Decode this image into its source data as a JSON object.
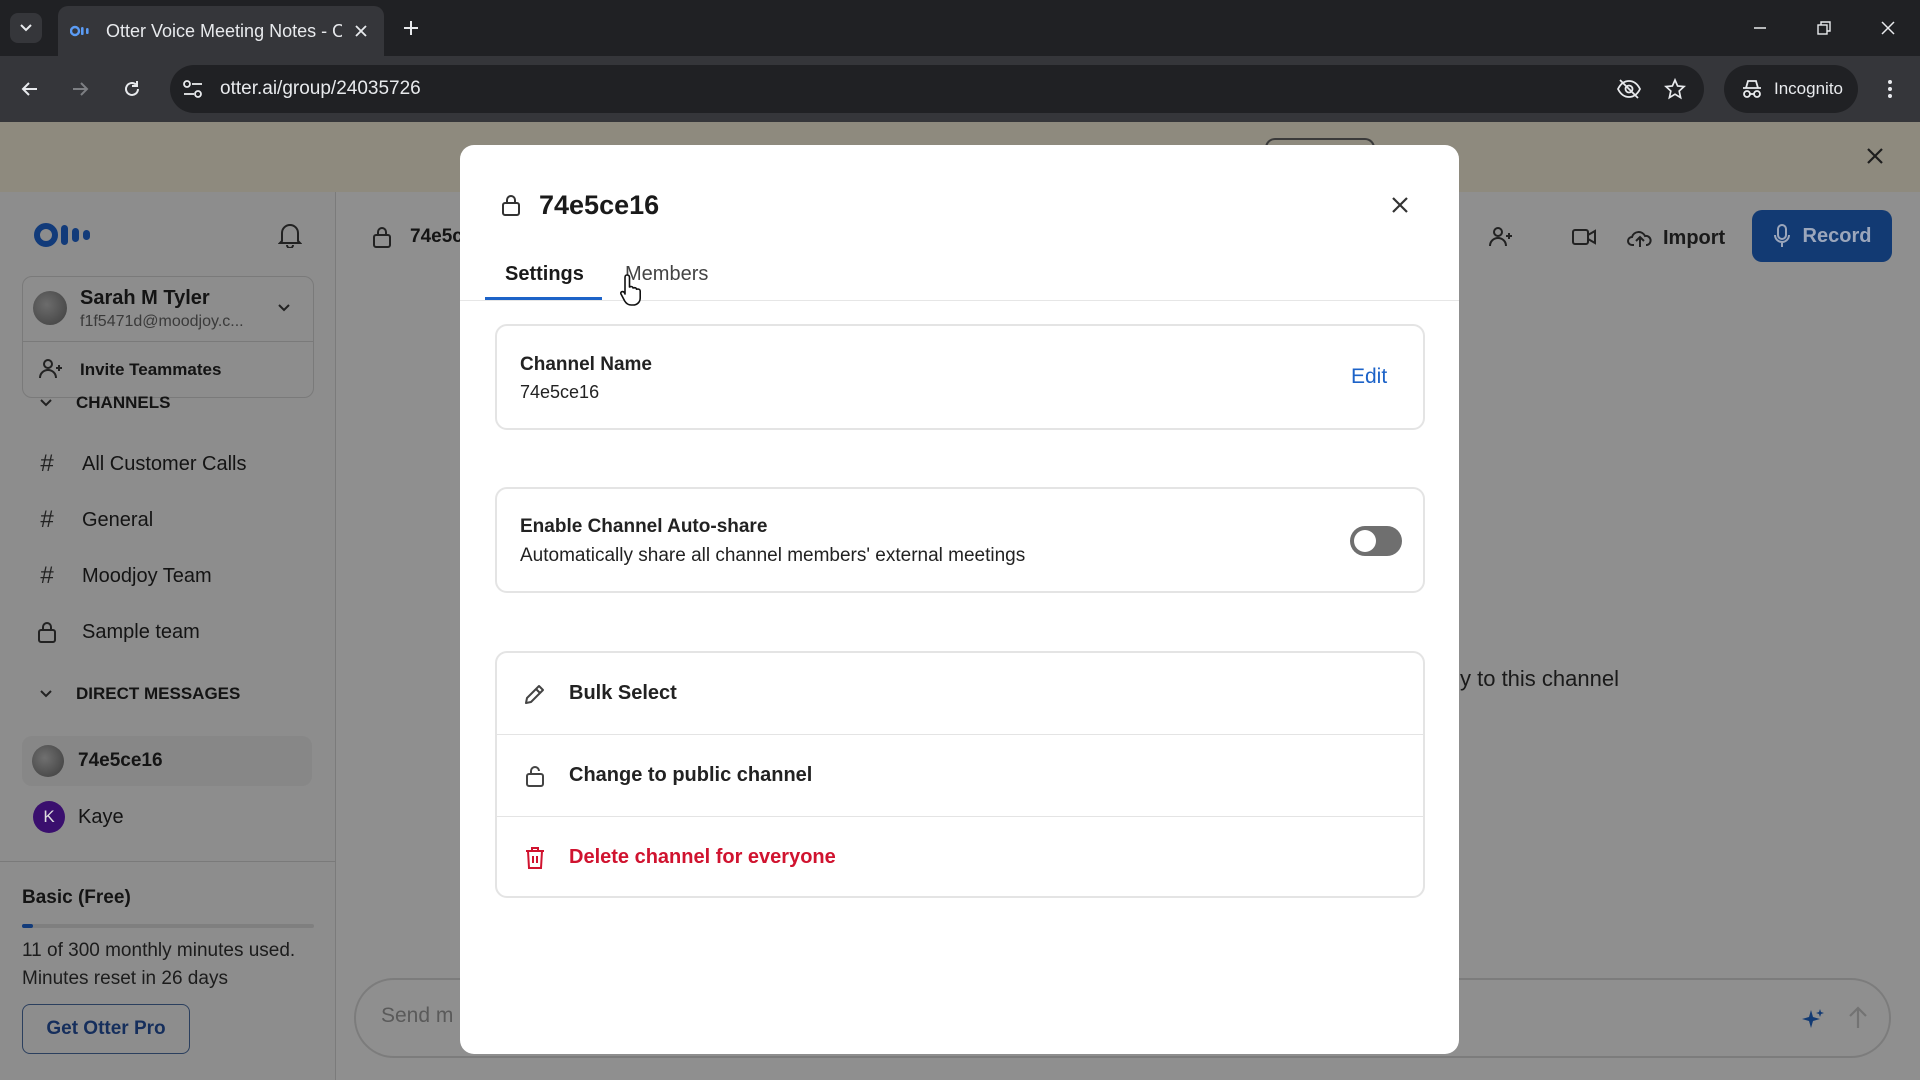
{
  "browser": {
    "tab_title": "Otter Voice Meeting Notes - Ot",
    "url": "otter.ai/group/24035726",
    "incognito_label": "Incognito"
  },
  "sidebar": {
    "user_name": "Sarah M Tyler",
    "user_email": "f1f5471d@moodjoy.c...",
    "invite_label": "Invite Teammates",
    "channels_header": "CHANNELS",
    "channels": [
      {
        "label": "All Customer Calls",
        "icon": "hash-icon"
      },
      {
        "label": "General",
        "icon": "hash-icon"
      },
      {
        "label": "Moodjoy Team",
        "icon": "hash-icon"
      },
      {
        "label": "Sample team",
        "icon": "lock-icon"
      }
    ],
    "dm_header": "DIRECT MESSAGES",
    "direct_messages": [
      {
        "label": "74e5ce16",
        "avatar": "photo"
      },
      {
        "label": "Kaye",
        "avatar_letter": "K"
      }
    ],
    "plan": {
      "name": "Basic (Free)",
      "usage_text": "11 of 300 monthly minutes used.",
      "reset_text": "Minutes reset in 26 days",
      "used_minutes": 11,
      "total_minutes": 300,
      "cta": "Get Otter Pro"
    }
  },
  "main": {
    "channel_title_partial": "74e5c",
    "import_label": "Import",
    "record_label": "Record",
    "empty_text_partial": "y to this channel",
    "composer_placeholder_partial": "Send m"
  },
  "modal": {
    "title": "74e5ce16",
    "tabs": [
      {
        "label": "Settings",
        "active": true
      },
      {
        "label": "Members",
        "active": false
      }
    ],
    "channel_name_label": "Channel Name",
    "channel_name_value": "74e5ce16",
    "edit_label": "Edit",
    "autoshare_title": "Enable Channel Auto-share",
    "autoshare_desc": "Automatically share all channel members' external meetings",
    "autoshare_enabled": false,
    "actions": [
      {
        "label": "Bulk Select",
        "icon": "pencil-icon"
      },
      {
        "label": "Change to public channel",
        "icon": "unlock-icon"
      },
      {
        "label": "Delete channel for everyone",
        "icon": "trash-icon",
        "danger": true
      }
    ]
  },
  "colors": {
    "accent": "#1d63c8",
    "danger": "#d0132f",
    "chrome_dark": "#202124",
    "chrome_toolbar": "#35363a"
  }
}
